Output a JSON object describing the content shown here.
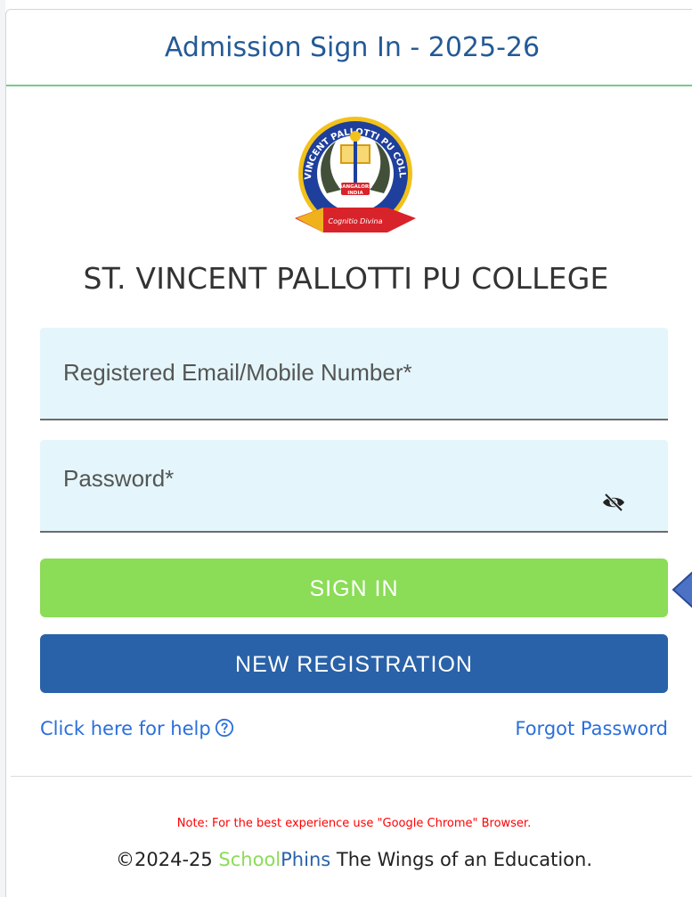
{
  "header": {
    "title": "Admission Sign In - 2025-26"
  },
  "logo": {
    "icon": "college-crest-logo",
    "ring_text": "ST. VINCENT PALLOTTI PU COLLEGE",
    "center_text_1": "BANGALORE",
    "center_text_2": "INDIA",
    "ribbon_text": "Cognitio Divina",
    "colors": {
      "ring": "#1f3f9c",
      "ribbon": "#d8232a",
      "gold": "#f2c21b"
    }
  },
  "college": {
    "name": "ST. VINCENT PALLOTTI PU COLLEGE"
  },
  "form": {
    "email_placeholder": "Registered Email/Mobile Number*",
    "email_value": "",
    "password_placeholder": "Password*",
    "password_value": "",
    "password_toggle_icon": "eye-slash-icon",
    "signin_label": "SIGN IN",
    "new_registration_label": "NEW REGISTRATION"
  },
  "links": {
    "help_label": "Click here for help",
    "help_icon": "question-circle-icon",
    "forgot_label": "Forgot Password"
  },
  "footer": {
    "note": "Note: For the best experience use \"Google Chrome\" Browser.",
    "copyright_prefix": "©2024-25 ",
    "brand_school": "School",
    "brand_phins": "Phins",
    "tagline": " The Wings of an Education."
  },
  "colors": {
    "title": "#245a96",
    "signin_button": "#8bdc57",
    "registration_button": "#2962a8",
    "link": "#2a6fdb",
    "field_background": "#e4f6fb",
    "note": "#ff0000"
  }
}
